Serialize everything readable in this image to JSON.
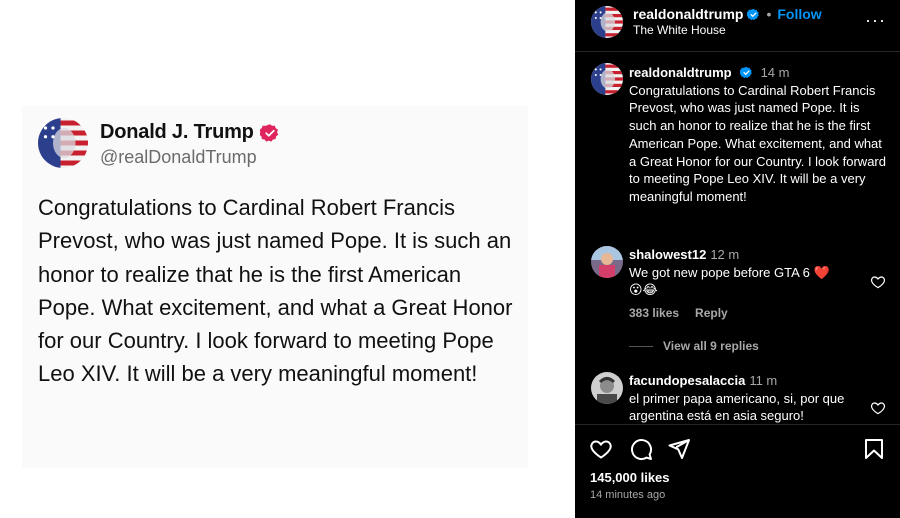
{
  "tweet": {
    "name": "Donald J. Trump",
    "handle": "@realDonaldTrump",
    "text": "Congratulations to Cardinal Robert Francis Prevost, who was just named Pope. It is such an honor to realize that he is the first American Pope. What excitement, and what a Great Honor for our Country. I look forward to meeting Pope Leo XIV. It will be a very meaningful moment!"
  },
  "instagram": {
    "header": {
      "username": "realdonaldtrump",
      "separator": "•",
      "follow_label": "Follow",
      "subtitle": "The White House",
      "more_label": "···"
    },
    "caption": {
      "username": "realdonaldtrump",
      "time": "14 m",
      "text": "Congratulations to Cardinal Robert Francis Prevost, who was just named Pope. It is such an honor to realize that he is the first American Pope. What excitement, and what a Great Honor for our Country. I look forward to meeting Pope Leo XIV. It will be a very meaningful moment!"
    },
    "comments": [
      {
        "username": "shalowest12",
        "time": "12 m",
        "text": "We got new pope before GTA 6 ❤️",
        "emoji_line": "😮😂",
        "likes": "383 likes",
        "reply_label": "Reply",
        "view_replies": "View all 9 replies"
      },
      {
        "username": "facundopesalaccia",
        "time": "11 m",
        "text": "el primer papa americano, si, por que argentina está en asia seguro!"
      }
    ],
    "likes": "145,000 likes",
    "time_ago": "14 minutes ago"
  },
  "colors": {
    "follow_blue": "#0095f6",
    "verified_pink": "#e0245e",
    "verified_blue": "#0095f6",
    "heart_red": "#ed4956"
  },
  "icons": [
    "verified-badge-icon",
    "more-icon",
    "heart-icon",
    "comment-icon",
    "share-icon",
    "bookmark-icon"
  ]
}
